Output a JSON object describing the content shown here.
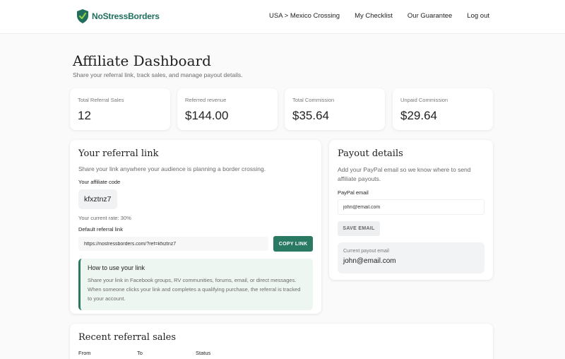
{
  "brand": {
    "name_part1": "NoStress",
    "name_part2": "Borders",
    "accent": "#2a7a63"
  },
  "nav": {
    "links": [
      "USA > Mexico Crossing",
      "My Checklist",
      "Our Guarantee",
      "Log out"
    ]
  },
  "header": {
    "title": "Affiliate Dashboard",
    "subtitle": "Share your referral link, track sales, and manage payout details."
  },
  "stats": [
    {
      "label": "Total Referral Sales",
      "value": "12"
    },
    {
      "label": "Referred revenue",
      "value": "$144.00"
    },
    {
      "label": "Total Commission",
      "value": "$35.64"
    },
    {
      "label": "Unpaid Commission",
      "value": "$29.64"
    }
  ],
  "referral": {
    "title": "Your referral link",
    "description": "Share your link anywhere your audience is planning a border crossing.",
    "code_label": "Your affiliate code",
    "code": "kfxztnz7",
    "rate_text": "Your current rate: 30%",
    "link_label": "Default referral link",
    "link_value": "https://nostressborders.com/?ref=kfxztnz7",
    "copy_button": "COPY LINK",
    "howto_title": "How to use your link",
    "howto_text": "Share your link in Facebook groups, RV communities, forums, email, or direct messages. When someone clicks your link and completes a qualifying purchase, the referral is tracked to your account."
  },
  "payout": {
    "title": "Payout details",
    "description": "Add your PayPal email so we know where to send affiliate payouts.",
    "email_label": "PayPal email",
    "email_value": "john@email.com",
    "save_button": "SAVE EMAIL",
    "current_label": "Current payout email",
    "current_value": "john@email.com"
  },
  "recent": {
    "title": "Recent referral sales",
    "columns": [
      "From",
      "To",
      "Status"
    ]
  }
}
